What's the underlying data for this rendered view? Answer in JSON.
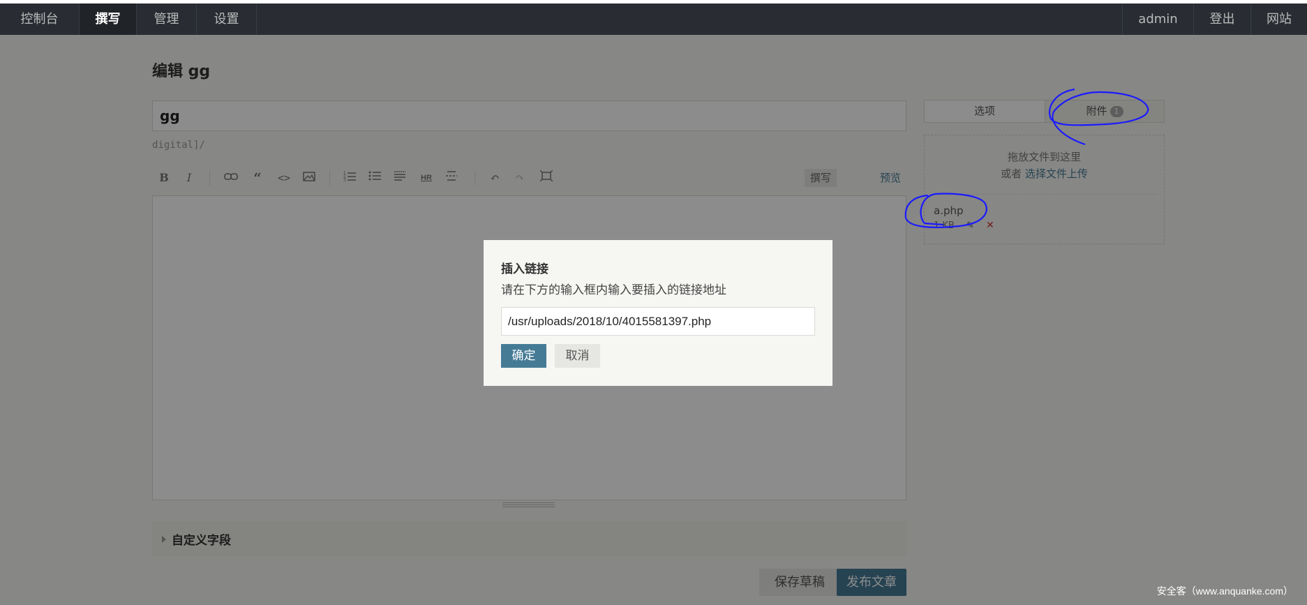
{
  "nav": {
    "left": [
      "控制台",
      "撰写",
      "管理",
      "设置"
    ],
    "right": [
      "admin",
      "登出",
      "网站"
    ]
  },
  "page": {
    "title": "编辑 gg",
    "post_title": "gg",
    "slug": "digital]/",
    "toolbar": {
      "write_tab": "撰写",
      "preview_tab": "预览"
    },
    "custom_fields": "自定义字段",
    "save_draft": "保存草稿",
    "publish": "发布文章"
  },
  "sidebar": {
    "tab_options": "选项",
    "tab_attachments": "附件",
    "attachment_count": "1",
    "drop_hint": "拖放文件到这里",
    "or_text": "或者",
    "select_upload": "选择文件上传",
    "file": {
      "name": "a.php",
      "size": "1 KB"
    }
  },
  "dialog": {
    "title": "插入链接",
    "description": "请在下方的输入框内输入要插入的链接地址",
    "url_value": "/usr/uploads/2018/10/4015581397.php",
    "ok": "确定",
    "cancel": "取消"
  },
  "watermark": "安全客（www.anquanke.com）",
  "colors": {
    "accent": "#467b96",
    "navbar": "#292d33",
    "annotation": "#1a1aff"
  }
}
